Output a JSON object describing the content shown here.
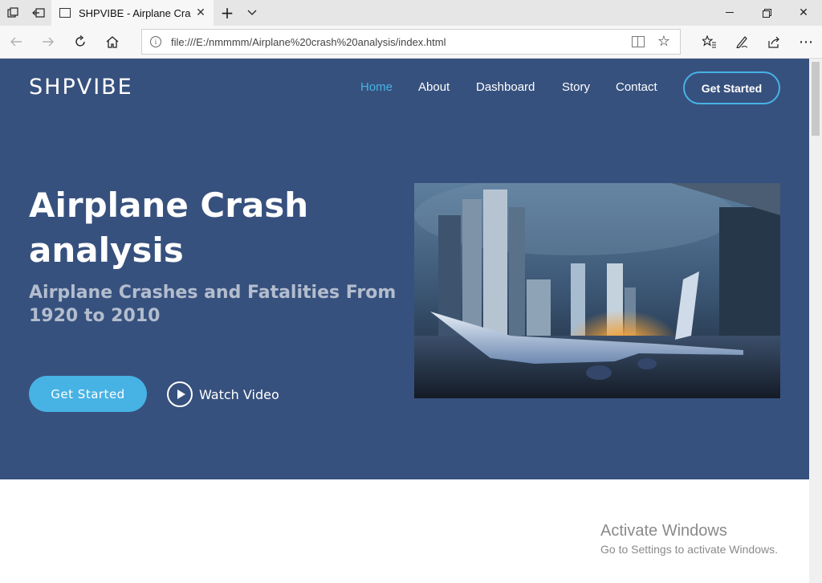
{
  "browser": {
    "tab_title": "SHPVIBE - Airplane Crash",
    "url": "file:///E:/nmmmm/Airplane%20crash%20analysis/index.html"
  },
  "site": {
    "logo": "SHPVIBE",
    "nav": [
      "Home",
      "About",
      "Dashboard",
      "Story",
      "Contact"
    ],
    "nav_active": "Home",
    "cta_top": "Get Started",
    "accent": "#47b2e4",
    "hero_bg": "#37517e"
  },
  "hero": {
    "title": "Airplane Crash analysis",
    "subtitle": "Airplane Crashes and Fatalities From 1920 to 2010",
    "primary_button": "Get Started",
    "video_link": "Watch Video"
  },
  "watermark": {
    "title": "Activate Windows",
    "subtitle": "Go to Settings to activate Windows."
  }
}
